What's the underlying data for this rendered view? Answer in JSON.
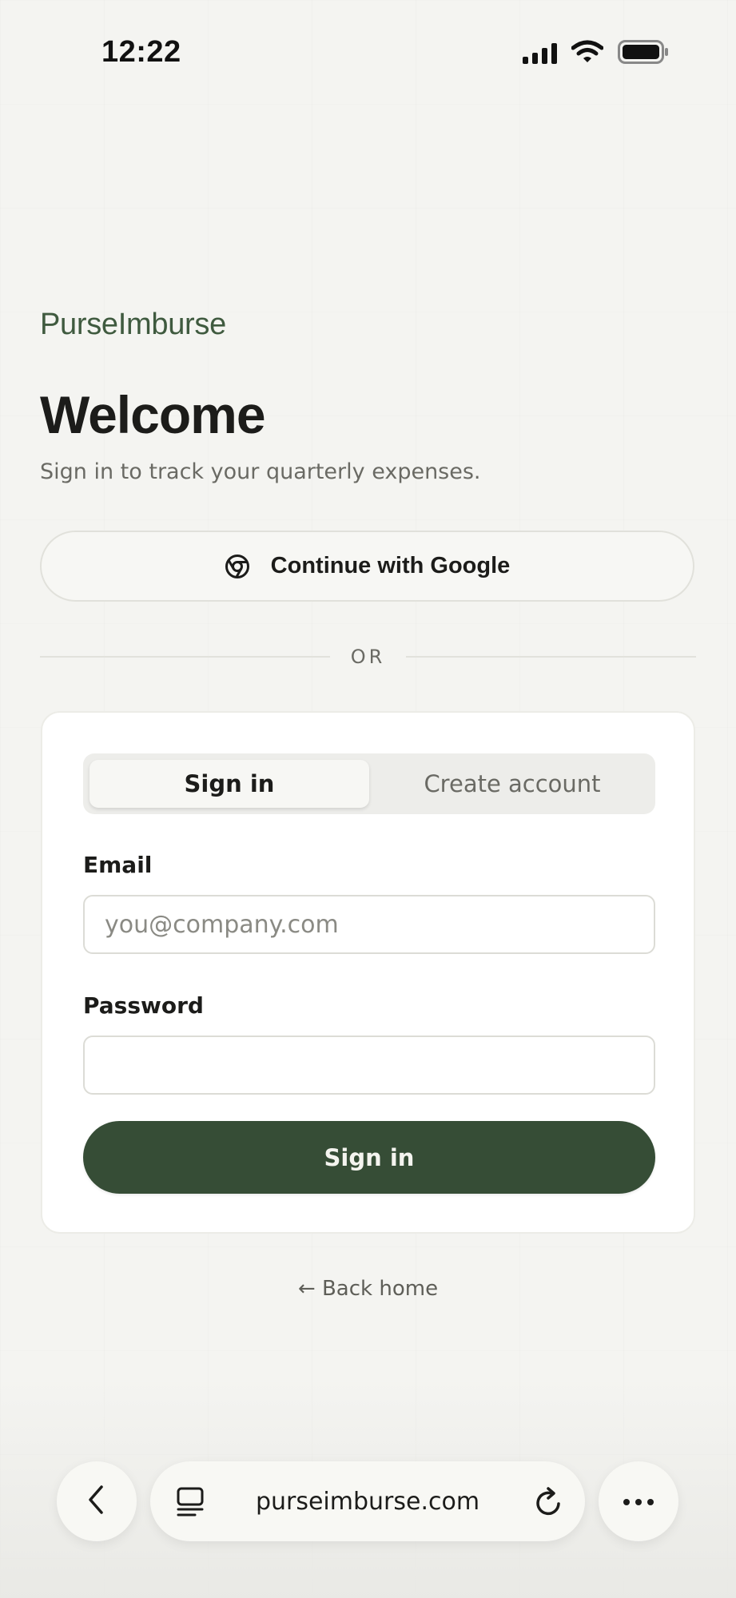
{
  "status_bar": {
    "time": "12:22"
  },
  "brand": {
    "name": "PurseImburse",
    "color": "#3f5a3f"
  },
  "heading": {
    "title": "Welcome",
    "subtitle": "Sign in to track your quarterly expenses."
  },
  "google_button": {
    "label": "Continue with Google",
    "icon": "chrome-icon"
  },
  "divider": {
    "label": "OR"
  },
  "auth_card": {
    "tabs": [
      {
        "label": "Sign in",
        "active": true
      },
      {
        "label": "Create account",
        "active": false
      }
    ],
    "email": {
      "label": "Email",
      "placeholder": "you@company.com",
      "value": ""
    },
    "password": {
      "label": "Password",
      "value": ""
    },
    "submit_label": "Sign in",
    "accent_color": "#364d36"
  },
  "back_link": {
    "label": "← Back home"
  },
  "browser_bar": {
    "url": "purseimburse.com",
    "icons": [
      "back-icon",
      "tabs-icon",
      "reload-icon",
      "more-icon"
    ]
  }
}
